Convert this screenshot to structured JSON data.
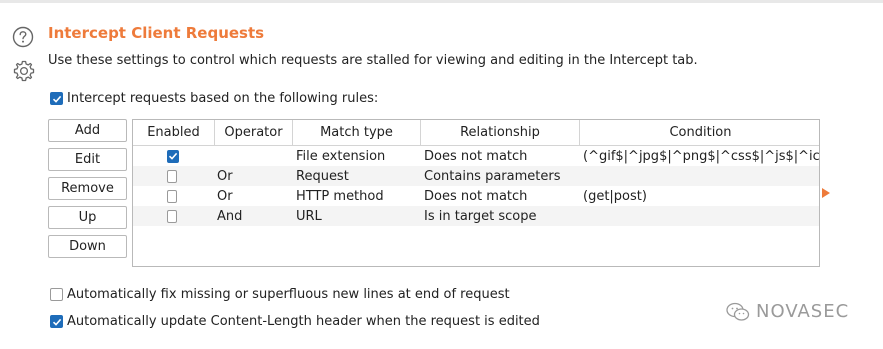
{
  "section": {
    "title": "Intercept Client Requests",
    "description": "Use these settings to control which requests are stalled for viewing and editing in the Intercept tab.",
    "help_icon": "help-circle-icon",
    "settings_icon": "gear-icon"
  },
  "rules_toggle": {
    "label": "Intercept requests based on the following rules:",
    "checked": true
  },
  "buttons": {
    "add": "Add",
    "edit": "Edit",
    "remove": "Remove",
    "up": "Up",
    "down": "Down"
  },
  "table": {
    "columns": [
      "Enabled",
      "Operator",
      "Match type",
      "Relationship",
      "Condition"
    ],
    "rows": [
      {
        "enabled": true,
        "operator": "",
        "match_type": "File extension",
        "relationship": "Does not match",
        "condition": "(^gif$|^jpg$|^png$|^css$|^js$|^ic..."
      },
      {
        "enabled": false,
        "operator": "Or",
        "match_type": "Request",
        "relationship": "Contains parameters",
        "condition": ""
      },
      {
        "enabled": false,
        "operator": "Or",
        "match_type": "HTTP method",
        "relationship": "Does not match",
        "condition": "(get|post)"
      },
      {
        "enabled": false,
        "operator": "And",
        "match_type": "URL",
        "relationship": "Is in target scope",
        "condition": ""
      }
    ]
  },
  "options": {
    "fix_newlines": {
      "label": "Automatically fix missing or superfluous new lines at end of request",
      "checked": false
    },
    "update_content_length": {
      "label": "Automatically update Content-Length header when the request is edited",
      "checked": true
    }
  },
  "watermark": {
    "text": "NOVASEC",
    "icon": "wechat-icon"
  },
  "colors": {
    "accent": "#ee7b3b",
    "checkbox": "#1e6cb9"
  }
}
